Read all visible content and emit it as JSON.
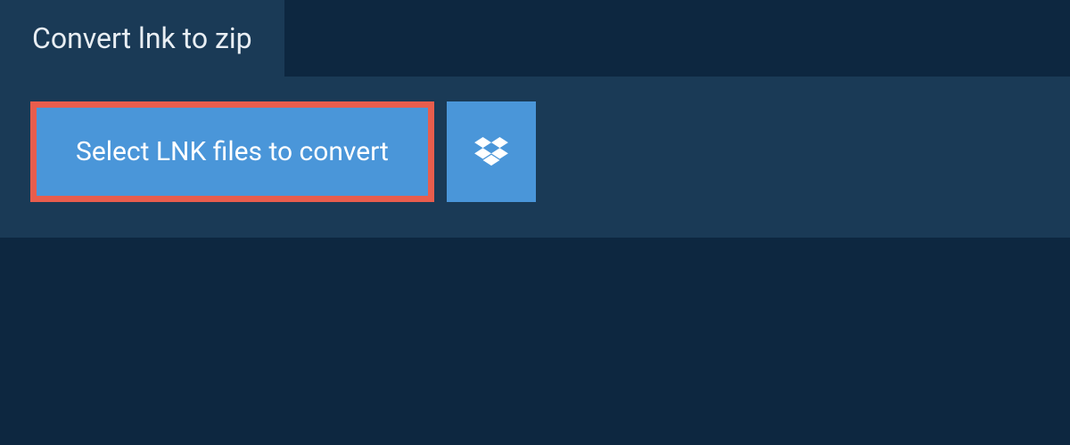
{
  "tab": {
    "title": "Convert lnk to zip"
  },
  "actions": {
    "select_files_label": "Select LNK files to convert"
  },
  "colors": {
    "background_dark": "#0d2740",
    "panel": "#1a3a56",
    "button_primary": "#4a96d9",
    "highlight_border": "#e85d4d",
    "text_light": "#e8eef3",
    "text_white": "#ffffff"
  }
}
